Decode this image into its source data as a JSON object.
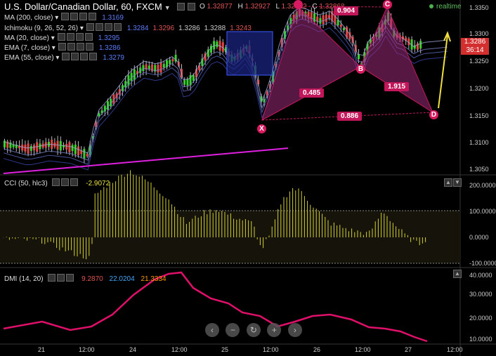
{
  "header": {
    "symbol": "U.S. Dollar/Canadian Dollar, 60, FXCM",
    "ohlc": [
      {
        "k": "O",
        "v": "1.32877"
      },
      {
        "k": "H",
        "v": "1.32927"
      },
      {
        "k": "L",
        "v": "1.32842"
      },
      {
        "k": "C",
        "v": "1.32868"
      }
    ],
    "realtime": "realtime"
  },
  "indicators": [
    {
      "label": "MA (200, close)",
      "values": [
        "1.3169"
      ],
      "colors": [
        "#5c7cfa"
      ]
    },
    {
      "label": "Ichimoku (9, 26, 52, 26)",
      "values": [
        "1.3284",
        "1.3296",
        "1.3286",
        "1.3288",
        "1.3243"
      ],
      "colors": [
        "#5c7cfa",
        "#e05454",
        "#cccccc",
        "#cccccc",
        "#e05454"
      ]
    },
    {
      "label": "MA (20, close)",
      "values": [
        "1.3295"
      ],
      "colors": [
        "#5c7cfa"
      ]
    },
    {
      "label": "EMA (7, close)",
      "values": [
        "1.3286"
      ],
      "colors": [
        "#5c7cfa"
      ]
    },
    {
      "label": "EMA (55, close)",
      "values": [
        "1.3279"
      ],
      "colors": [
        "#5c7cfa"
      ]
    }
  ],
  "price_axis": [
    "1.3350",
    "1.3300",
    "1.3250",
    "1.3200",
    "1.3150",
    "1.3100",
    "1.3050"
  ],
  "price_tag": {
    "price": "1.3286",
    "countdown": "36:14"
  },
  "pattern": {
    "points": [
      "X",
      "B",
      "C",
      "D"
    ],
    "ratios": [
      "0.904",
      "0.485",
      "1.915",
      "0.886"
    ]
  },
  "cci": {
    "label": "CCI (50, hlc3)",
    "value": "-2.9072",
    "axis": [
      "200.0000",
      "100.0000",
      "0.0000",
      "-100.0000"
    ]
  },
  "dmi": {
    "label": "DMI (14, 20)",
    "values": [
      "9.2870",
      "22.0204",
      "21.3334"
    ],
    "colors": [
      "#e05454",
      "#42a5f5",
      "#ff9800"
    ],
    "axis": [
      "40.0000",
      "30.0000",
      "20.0000",
      "10.0000"
    ]
  },
  "time_axis": [
    "21",
    "12:00",
    "24",
    "12:00",
    "25",
    "12:00",
    "26",
    "12:00",
    "27",
    "12:00"
  ],
  "nav": {
    "back": "‹",
    "zoom_out": "−",
    "reset": "↻",
    "zoom_in": "+",
    "forward": "›"
  },
  "colors": {
    "up_candle": "#39d12d",
    "down_candle": "#e04848",
    "pattern_fill": "#9c2a7a",
    "pattern_line": "#c2185b",
    "cci_bars": "#d4d035",
    "dmi_line": "#e0106a",
    "trend_line": "#e020e0",
    "arrow": "#f0e040"
  }
}
